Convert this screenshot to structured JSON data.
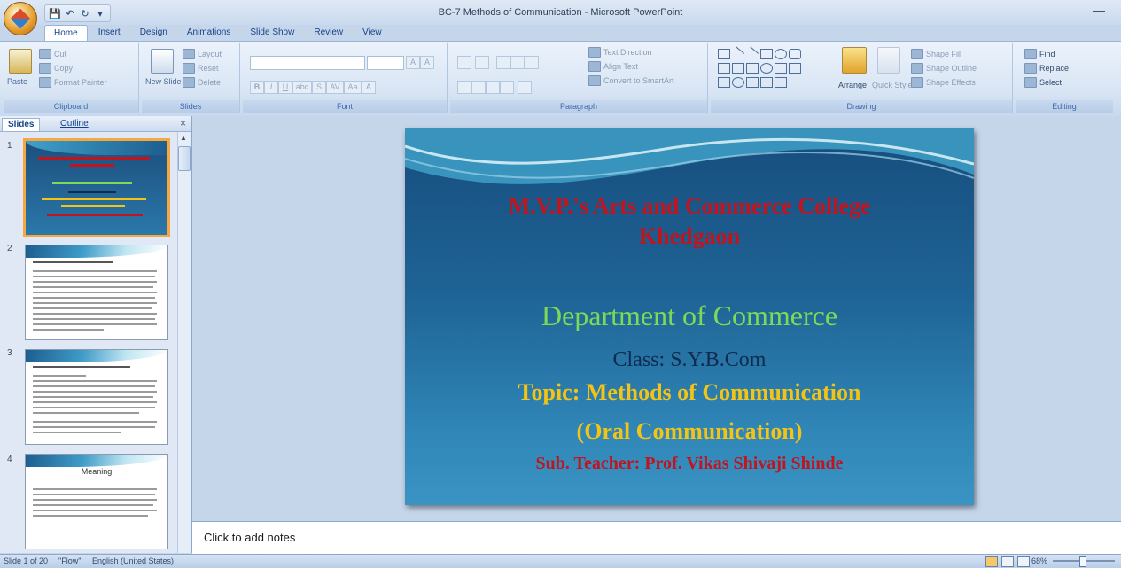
{
  "window": {
    "title": "BC-7 Methods of Communication - Microsoft PowerPoint",
    "minimize": "—"
  },
  "qat": {
    "save": "💾",
    "undo": "↶",
    "redo": "↻",
    "more": "▾"
  },
  "ribbon": {
    "tabs": [
      "Home",
      "Insert",
      "Design",
      "Animations",
      "Slide Show",
      "Review",
      "View"
    ],
    "active_tab": "Home",
    "clipboard": {
      "label": "Clipboard",
      "paste": "Paste",
      "cut": "Cut",
      "copy": "Copy",
      "format_painter": "Format Painter"
    },
    "slides": {
      "label": "Slides",
      "new_slide": "New Slide",
      "layout": "Layout",
      "reset": "Reset",
      "delete": "Delete"
    },
    "font": {
      "label": "Font",
      "bold": "B",
      "italic": "I",
      "underline": "U",
      "strike": "abc",
      "shadow": "S",
      "spacing": "AV",
      "case": "Aa",
      "color": "A",
      "grow": "A",
      "shrink": "A"
    },
    "paragraph": {
      "label": "Paragraph",
      "text_direction": "Text Direction",
      "align_text": "Align Text",
      "convert_smartart": "Convert to SmartArt"
    },
    "drawing": {
      "label": "Drawing",
      "arrange": "Arrange",
      "quick_styles": "Quick Styles",
      "shape_fill": "Shape Fill",
      "shape_outline": "Shape Outline",
      "shape_effects": "Shape Effects"
    },
    "editing": {
      "label": "Editing",
      "find": "Find",
      "replace": "Replace",
      "select": "Select"
    }
  },
  "pane": {
    "tab_slides": "Slides",
    "tab_outline": "Outline",
    "close": "×",
    "scroll_up": "▲"
  },
  "thumbnails": [
    {
      "num": "1"
    },
    {
      "num": "2"
    },
    {
      "num": "3"
    },
    {
      "num": "4",
      "title": "Meaning"
    }
  ],
  "slide": {
    "college": "M.V.P.'s Arts and Commerce College",
    "place": "Khedgaon",
    "department": "Department of Commerce",
    "class": "Class: S.Y.B.Com",
    "topic": "Topic: Methods of Communication",
    "subtopic": "(Oral Communication)",
    "teacher": "Sub. Teacher: Prof. Vikas Shivaji Shinde"
  },
  "notes": {
    "placeholder": "Click to add notes"
  },
  "status": {
    "slide_info": "Slide 1 of 20",
    "theme": "\"Flow\"",
    "language": "English (United States)",
    "zoom": "68%"
  }
}
